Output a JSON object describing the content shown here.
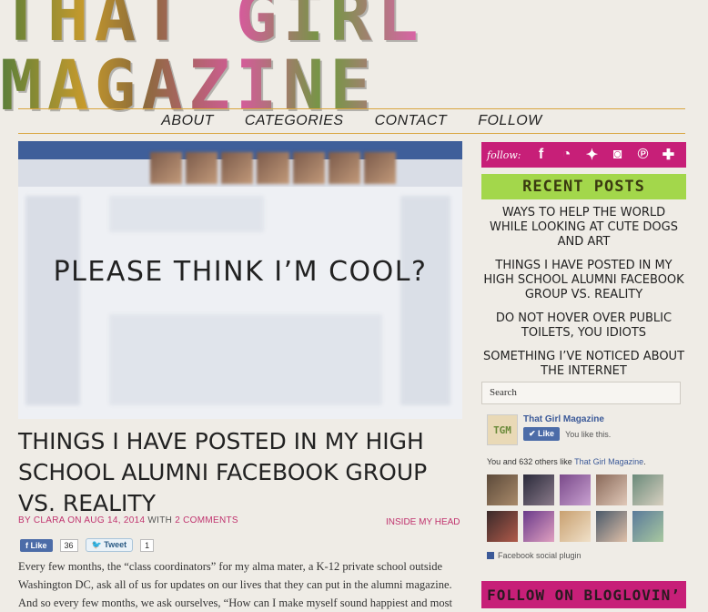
{
  "site": {
    "title": "THAT GIRL MAGAZINE"
  },
  "nav": [
    "ABOUT",
    "CATEGORIES",
    "CONTACT",
    "FOLLOW"
  ],
  "hero": {
    "caption": "PLEASE THINK I’M COOL?"
  },
  "post": {
    "title": "THINGS I HAVE POSTED IN MY HIGH SCHOOL ALUMNI FACEBOOK GROUP VS. REALITY",
    "byline_author": "BY CLARA ON AUG 14, 2014",
    "byline_with": " WITH ",
    "byline_comments": "2 COMMENTS",
    "category": "INSIDE MY HEAD",
    "like_label": "Like",
    "like_count": "36",
    "tweet_label": "Tweet",
    "tweet_count": "1",
    "body": "Every few months, the “class coordinators” for my alma mater, a K-12 private school outside Washington DC, ask all of us for updates on our lives that they can put in the alumni magazine. And so every few months, we ask ourselves, “How can I make myself sound happiest and most"
  },
  "sidebar": {
    "follow_label": "follow:",
    "follow_icons": [
      "facebook-icon",
      "rss-icon",
      "twitter-icon",
      "instagram-icon",
      "pinterest-icon",
      "plus-icon"
    ],
    "recent_heading": "RECENT POSTS",
    "recent_posts": [
      "WAYS TO HELP THE WORLD WHILE LOOKING AT CUTE DOGS AND ART",
      "THINGS I HAVE POSTED IN MY HIGH SCHOOL ALUMNI FACEBOOK GROUP VS. REALITY",
      "DO NOT HOVER OVER PUBLIC TOILETS, YOU IDIOTS",
      "SOMETHING I’VE NOTICED ABOUT THE INTERNET"
    ],
    "search_placeholder": "Search",
    "fb_page_name": "That Girl Magazine",
    "fb_logo_text": "TGM",
    "fb_like_label": "Like",
    "fb_you_like": "You like this.",
    "fb_others_prefix": "You and 632 others like ",
    "fb_others_link": "That Girl Magazine",
    "fb_others_suffix": ".",
    "fb_plugin": "Facebook social plugin",
    "bloglovin_heading": "FOLLOW ON BLOGLOVIN’"
  },
  "colors": {
    "accent_pink": "#c71f78",
    "accent_green": "#a3d74b",
    "gold_rule": "#d9a640"
  }
}
